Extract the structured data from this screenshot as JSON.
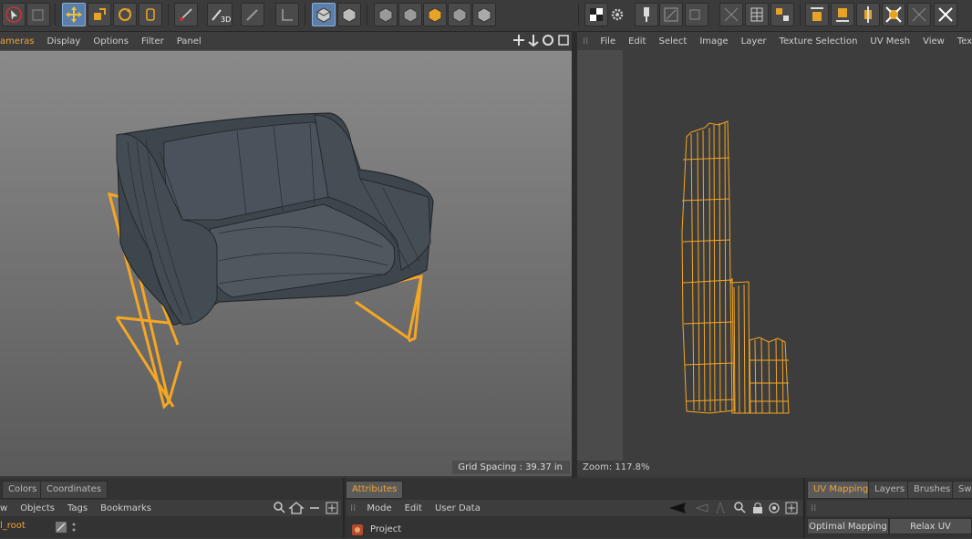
{
  "viewport_menu": {
    "items": [
      "ameras",
      "Display",
      "Options",
      "Filter",
      "Panel"
    ],
    "active_index": 0
  },
  "viewport": {
    "grid_spacing": "Grid Spacing : 39.37 in"
  },
  "uv_menu": {
    "items": [
      "File",
      "Edit",
      "Select",
      "Image",
      "Layer",
      "Texture Selection",
      "UV Mesh",
      "View",
      "Textur"
    ]
  },
  "uv_view": {
    "zoom": "Zoom: 117.8%"
  },
  "objects_panel": {
    "tabs": [
      "Colors",
      "Coordinates"
    ],
    "menu": [
      "w",
      "Objects",
      "Tags",
      "Bookmarks"
    ],
    "tree_item": "l_root"
  },
  "attributes_panel": {
    "tab": "Attributes",
    "menu": [
      "Mode",
      "Edit",
      "User Data"
    ],
    "item": "Project"
  },
  "uv_panel": {
    "tabs": [
      "UV Mapping",
      "Layers",
      "Brushes",
      "Swa"
    ],
    "buttons": [
      "Optimal Mapping",
      "Relax UV"
    ]
  },
  "toolbar": {
    "label_3d": "3D"
  },
  "colors": {
    "accent": "#f0a33a",
    "wire_highlight": "#f5a623"
  }
}
